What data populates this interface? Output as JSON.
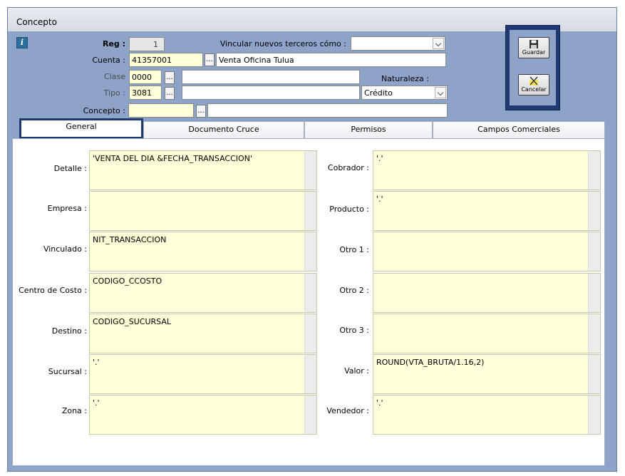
{
  "window": {
    "title": "Concepto"
  },
  "header": {
    "reg_label": "Reg :",
    "reg_value": "1",
    "vincular_label": "Vincular nuevos terceros cómo :",
    "vincular_value": "",
    "cuenta_label": "Cuenta :",
    "cuenta_code": "41357001",
    "cuenta_desc": "Venta Oficina Tulua",
    "clase_label": "Clase",
    "clase_code": "0000",
    "clase_desc": "",
    "tipo_label": "Tipo :",
    "tipo_code": "3081",
    "tipo_desc": "",
    "naturaleza_label": "Naturaleza :",
    "naturaleza_value": "Crédito",
    "concepto_label": "Concepto :",
    "concepto_code": "",
    "concepto_desc": "",
    "ellipsis": "..."
  },
  "actions": {
    "save_label": "Guardar",
    "cancel_label": "Cancelar"
  },
  "tabs": [
    {
      "label": "General",
      "active": true
    },
    {
      "label": "Documento Cruce",
      "active": false
    },
    {
      "label": "Permisos",
      "active": false
    },
    {
      "label": "Campos Comerciales",
      "active": false
    }
  ],
  "left_fields": [
    {
      "label": "Detalle :",
      "value": "'VENTA DEL DIA &FECHA_TRANSACCION'"
    },
    {
      "label": "Empresa :",
      "value": ""
    },
    {
      "label": "Vinculado :",
      "value": "NIT_TRANSACCION"
    },
    {
      "label": "Centro de Costo :",
      "value": "CODIGO_CCOSTO"
    },
    {
      "label": "Destino :",
      "value": "CODIGO_SUCURSAL"
    },
    {
      "label": "Sucursal :",
      "value": "'.'"
    },
    {
      "label": "Zona :",
      "value": "'.'"
    }
  ],
  "right_fields": [
    {
      "label": "Cobrador :",
      "value": "'.'"
    },
    {
      "label": "Producto :",
      "value": "'.'"
    },
    {
      "label": "Otro 1 :",
      "value": ""
    },
    {
      "label": "Otro 2 :",
      "value": ""
    },
    {
      "label": "Otro 3 :",
      "value": ""
    },
    {
      "label": "Valor :",
      "value": "ROUND(VTA_BRUTA/1.16,2)"
    },
    {
      "label": "Vendedor :",
      "value": "'.'"
    }
  ],
  "colors": {
    "window_bg": "#8da3c7",
    "field_bg": "#ffffd9",
    "accent_border": "#1f3973"
  }
}
